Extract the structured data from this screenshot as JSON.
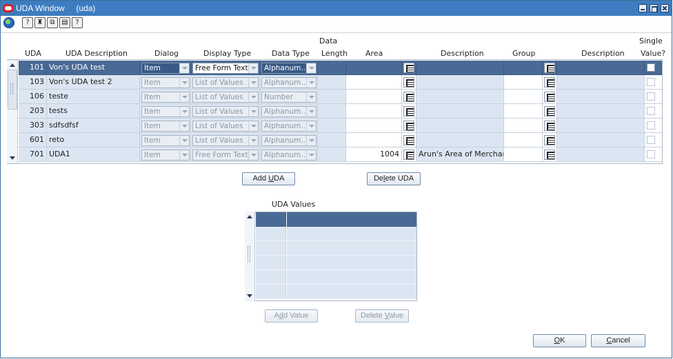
{
  "window": {
    "title": "UDA Window     (uda)"
  },
  "toolbar": {
    "icons": [
      "globe-icon",
      "help-action-icon",
      "find-icon",
      "copy-icon",
      "print-icon",
      "help-icon"
    ]
  },
  "grid": {
    "headers": {
      "uda": "UDA",
      "uda_description": "UDA Description",
      "dialog": "Dialog",
      "display_type": "Display Type",
      "data_type": "Data Type",
      "data_length_1": "Data",
      "data_length_2": "Length",
      "area": "Area",
      "area_description": "Description",
      "group": "Group",
      "group_description": "Description",
      "single_value_1": "Single",
      "single_value_2": "Value?"
    },
    "rows": [
      {
        "uda": "101",
        "desc": "Von's UDA test",
        "dialog": "Item",
        "display": "Free Form Text",
        "datatype": "Alphanum...",
        "length": "",
        "area": "",
        "area_desc": "",
        "group": "",
        "group_desc": ""
      },
      {
        "uda": "103",
        "desc": "Von's UDA test 2",
        "dialog": "Item",
        "display": "List of Values",
        "datatype": "Alphanum...",
        "length": "",
        "area": "",
        "area_desc": "",
        "group": "",
        "group_desc": ""
      },
      {
        "uda": "106",
        "desc": "teste",
        "dialog": "Item",
        "display": "List of Values",
        "datatype": "Number",
        "length": "",
        "area": "",
        "area_desc": "",
        "group": "",
        "group_desc": ""
      },
      {
        "uda": "203",
        "desc": "tests",
        "dialog": "Item",
        "display": "List of Values",
        "datatype": "Alphanum...",
        "length": "",
        "area": "",
        "area_desc": "",
        "group": "",
        "group_desc": ""
      },
      {
        "uda": "303",
        "desc": "sdfsdfsf",
        "dialog": "Item",
        "display": "List of Values",
        "datatype": "Alphanum...",
        "length": "",
        "area": "",
        "area_desc": "",
        "group": "",
        "group_desc": ""
      },
      {
        "uda": "601",
        "desc": "reto",
        "dialog": "Item",
        "display": "List of Values",
        "datatype": "Alphanum...",
        "length": "",
        "area": "",
        "area_desc": "",
        "group": "",
        "group_desc": ""
      },
      {
        "uda": "701",
        "desc": "UDA1",
        "dialog": "Item",
        "display": "Free Form Text",
        "datatype": "Alphanum...",
        "length": "",
        "area": "1004",
        "area_desc": "Arun's Area of Merchandi:",
        "group": "",
        "group_desc": ""
      }
    ]
  },
  "buttons": {
    "add_uda": "Add UDA",
    "add_uda_mn": "U",
    "delete_uda": "Delete UDA",
    "delete_uda_mn": "l",
    "add_value": "Add Value",
    "add_value_mn": "d",
    "delete_value": "Delete Value",
    "delete_value_mn": "V",
    "ok": "OK",
    "ok_mn": "O",
    "cancel": "Cancel",
    "cancel_mn": "C"
  },
  "uda_values": {
    "label": "UDA Values",
    "row_count": 6
  }
}
